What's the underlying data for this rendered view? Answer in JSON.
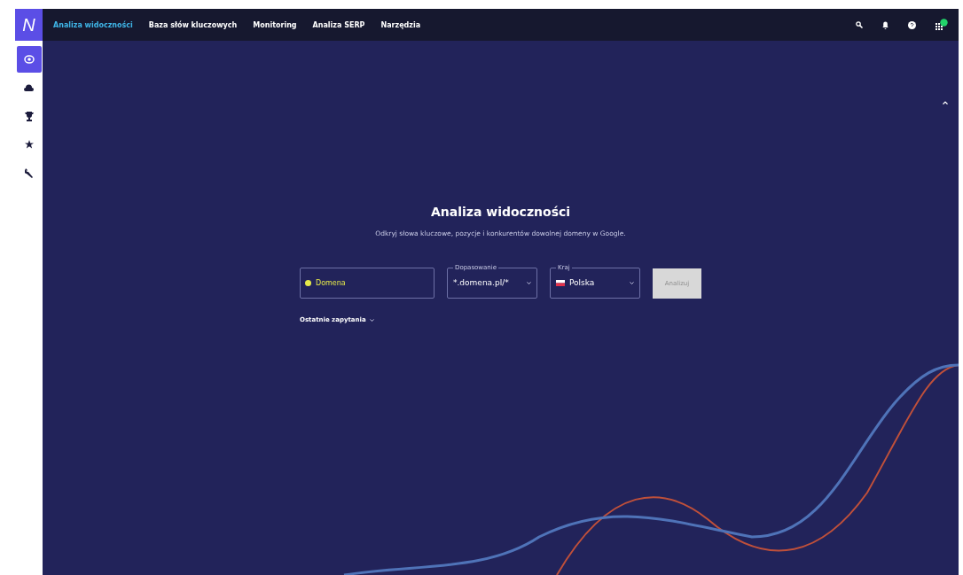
{
  "nav": [
    {
      "label": "Analiza widoczności",
      "selected": true
    },
    {
      "label": "Baza słów kluczowych",
      "selected": false
    },
    {
      "label": "Monitoring",
      "selected": false
    },
    {
      "label": "Analiza SERP",
      "selected": false
    },
    {
      "label": "Narzędzia",
      "selected": false
    }
  ],
  "sidebar": {
    "items": [
      {
        "kind": "eye",
        "selected": true
      },
      {
        "kind": "cloud",
        "selected": false
      },
      {
        "kind": "trophy",
        "selected": false
      },
      {
        "kind": "star",
        "selected": false
      },
      {
        "kind": "wrench",
        "selected": false
      }
    ]
  },
  "logo": "N",
  "title": "Analiza widoczności",
  "subtitle": "Odkryj słowa kluczowe, pozycje i konkurentów dowolnej domeny w Google.",
  "domain_field": {
    "placeholder": "Domena"
  },
  "match_select": {
    "label": "Dopasowanie",
    "value": "*.domena.pl/*"
  },
  "country_select": {
    "label": "Kraj",
    "value": "Polska"
  },
  "analyze_button": {
    "label": "Analizuj",
    "disabled": true
  },
  "recent": {
    "label": "Ostatnie zapytania"
  }
}
